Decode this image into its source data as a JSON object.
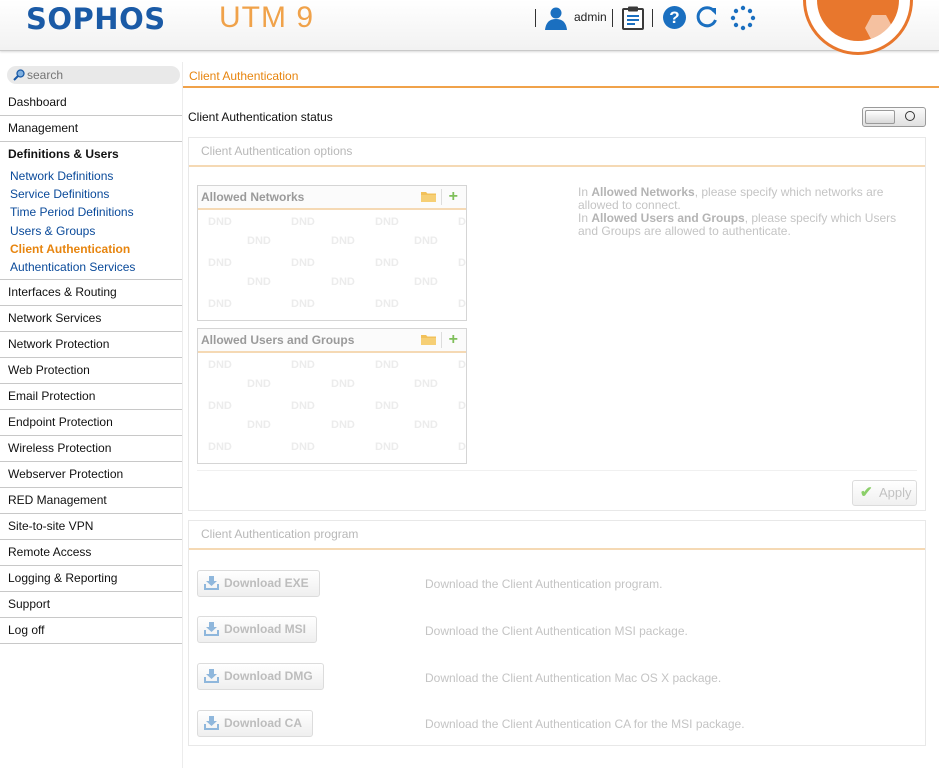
{
  "header": {
    "logo": "SOPHOS",
    "product": "UTM 9",
    "user": "admin",
    "icons": [
      "user-icon",
      "clipboard-icon",
      "help-icon",
      "reload-icon",
      "spinner-icon"
    ],
    "help_glyph": "?"
  },
  "sidebar": {
    "search_placeholder": "search",
    "items_top": [
      "Dashboard",
      "Management"
    ],
    "group_label": "Definitions & Users",
    "sub_items": [
      {
        "label": "Network Definitions",
        "active": false
      },
      {
        "label": "Service Definitions",
        "active": false
      },
      {
        "label": "Time Period Definitions",
        "active": false
      },
      {
        "label": "Users & Groups",
        "active": false
      },
      {
        "label": "Client Authentication",
        "active": true
      },
      {
        "label": "Authentication Services",
        "active": false
      }
    ],
    "items_bottom": [
      "Interfaces & Routing",
      "Network Services",
      "Network Protection",
      "Web Protection",
      "Email Protection",
      "Endpoint Protection",
      "Wireless Protection",
      "Webserver Protection",
      "RED Management",
      "Site-to-site VPN",
      "Remote Access",
      "Logging & Reporting",
      "Support",
      "Log off"
    ]
  },
  "main": {
    "tab": "Client Authentication",
    "status_label": "Client Authentication status",
    "status_enabled": false,
    "options": {
      "title": "Client Authentication options",
      "networks_panel": "Allowed Networks",
      "users_panel": "Allowed Users and Groups",
      "dnd": "DND",
      "help": {
        "p1_pre": "In ",
        "p1_bold": "Allowed Networks",
        "p1_post": ", please specify which networks are allowed to connect.",
        "p2_pre": "In ",
        "p2_bold": "Allowed Users and Groups",
        "p2_post": ", please specify which Users and Groups are allowed to authenticate."
      },
      "apply": "Apply"
    },
    "program": {
      "title": "Client Authentication program",
      "downloads": [
        {
          "button": "Download EXE",
          "desc": "Download the Client Authentication program."
        },
        {
          "button": "Download MSI",
          "desc": "Download the Client Authentication MSI package."
        },
        {
          "button": "Download DMG",
          "desc": "Download the Client Authentication Mac OS X package."
        },
        {
          "button": "Download CA",
          "desc": "Download the Client Authentication CA for the MSI package."
        }
      ]
    }
  },
  "colors": {
    "brand_blue": "#1a5aa6",
    "accent_orange": "#e7850f",
    "link_blue": "#0a4a9a"
  }
}
